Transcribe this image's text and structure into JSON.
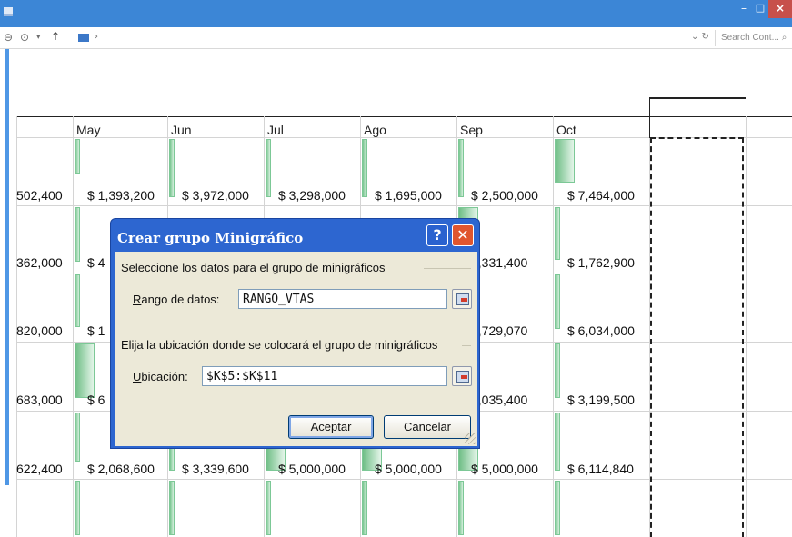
{
  "window": {
    "minimize_glyph": "–",
    "maximize_glyph": "□",
    "close_glyph": "×"
  },
  "addressbar": {
    "back_glyph": "⊖",
    "forward_glyph": "⊙",
    "dropdown_glyph": "▾",
    "up_glyph": "↑",
    "chevron_glyph": "›",
    "refresh_glyph": "⌄ ↻",
    "search_placeholder": "Search Cont...",
    "search_icon_glyph": "⌕"
  },
  "sheet": {
    "columns": [
      "May",
      "Jun",
      "Jul",
      "Ago",
      "Sep",
      "Oct"
    ],
    "rows": [
      [
        "502,400",
        "$ 1,393,200",
        "$ 3,972,000",
        "$ 3,298,000",
        "$ 1,695,000",
        "$ 2,500,000",
        "$ 7,464,000"
      ],
      [
        "362,000",
        "$ 4",
        "",
        "",
        "",
        "7,331,400",
        "$ 1,762,900"
      ],
      [
        "820,000",
        "$ 1",
        "",
        "",
        "",
        "1,729,070",
        "$ 6,034,000"
      ],
      [
        "683,000",
        "$ 6",
        "",
        "",
        "",
        "3,035,400",
        "$ 3,199,500"
      ],
      [
        "622,400",
        "$ 2,068,600",
        "$ 3,339,600",
        "$ 5,000,000",
        "$ 5,000,000",
        "$ 5,000,000",
        "$ 6,114,840"
      ]
    ]
  },
  "dialog": {
    "title": "Crear grupo Minigráfico",
    "help_glyph": "?",
    "close_glyph": "✕",
    "data_section": "Seleccione los datos para el grupo de minigráficos",
    "range_label_underlined": "R",
    "range_label_rest": "ango de datos:",
    "range_value": "RANGO_VTAS",
    "location_section": "Elija la ubicación donde se colocará el grupo de minigráficos",
    "location_label_underlined": "U",
    "location_label_rest": "bicación:",
    "location_value": "$K$5:$K$11",
    "ok_label": "Aceptar",
    "cancel_label": "Cancelar"
  }
}
